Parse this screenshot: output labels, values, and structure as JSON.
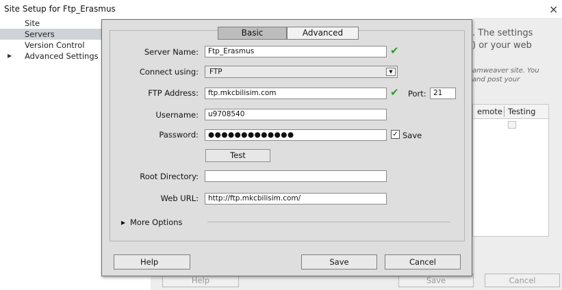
{
  "window": {
    "title": "Site Setup for Ftp_Erasmus",
    "close_glyph": "×"
  },
  "sidebar": {
    "items": [
      {
        "label": "Site"
      },
      {
        "label": "Servers",
        "selected": true
      },
      {
        "label": "Version Control"
      },
      {
        "label": "Advanced Settings",
        "expandable": true
      }
    ]
  },
  "background_panel": {
    "text_line_1": ". The settings",
    "text_line_2": ") or your web",
    "italic_line_1": "amweaver site. You",
    "italic_line_2": "and post your",
    "table_headers": [
      "emote",
      "Testing"
    ],
    "buttons": {
      "help": "Help",
      "save": "Save",
      "cancel": "Cancel"
    }
  },
  "dialog": {
    "tabs": [
      {
        "label": "Basic",
        "active": true
      },
      {
        "label": "Advanced",
        "active": false
      }
    ],
    "fields": {
      "server_name": {
        "label": "Server Name:",
        "value": "Ftp_Erasmus"
      },
      "connect_using": {
        "label": "Connect using:",
        "value": "FTP"
      },
      "ftp_address": {
        "label": "FTP Address:",
        "value": "ftp.mkcbilisim.com"
      },
      "port": {
        "label": "Port:",
        "value": "21"
      },
      "username": {
        "label": "Username:",
        "value": "u9708540"
      },
      "password": {
        "label": "Password:",
        "value": "●●●●●●●●●●●●●"
      },
      "save_password": {
        "label": "Save",
        "checked": true
      },
      "root_directory": {
        "label": "Root Directory:",
        "value": ""
      },
      "web_url": {
        "label": "Web URL:",
        "value": "http://ftp.mkcbilisim.com/"
      }
    },
    "test_button": "Test",
    "more_options": "More Options",
    "buttons": {
      "help": "Help",
      "save": "Save",
      "cancel": "Cancel"
    },
    "valid_check_color": "#2e9b2e"
  },
  "glyphs": {
    "check": "✔",
    "checkbox_checked": "✓",
    "triangle_right": "▶",
    "triangle_down": "▼"
  }
}
